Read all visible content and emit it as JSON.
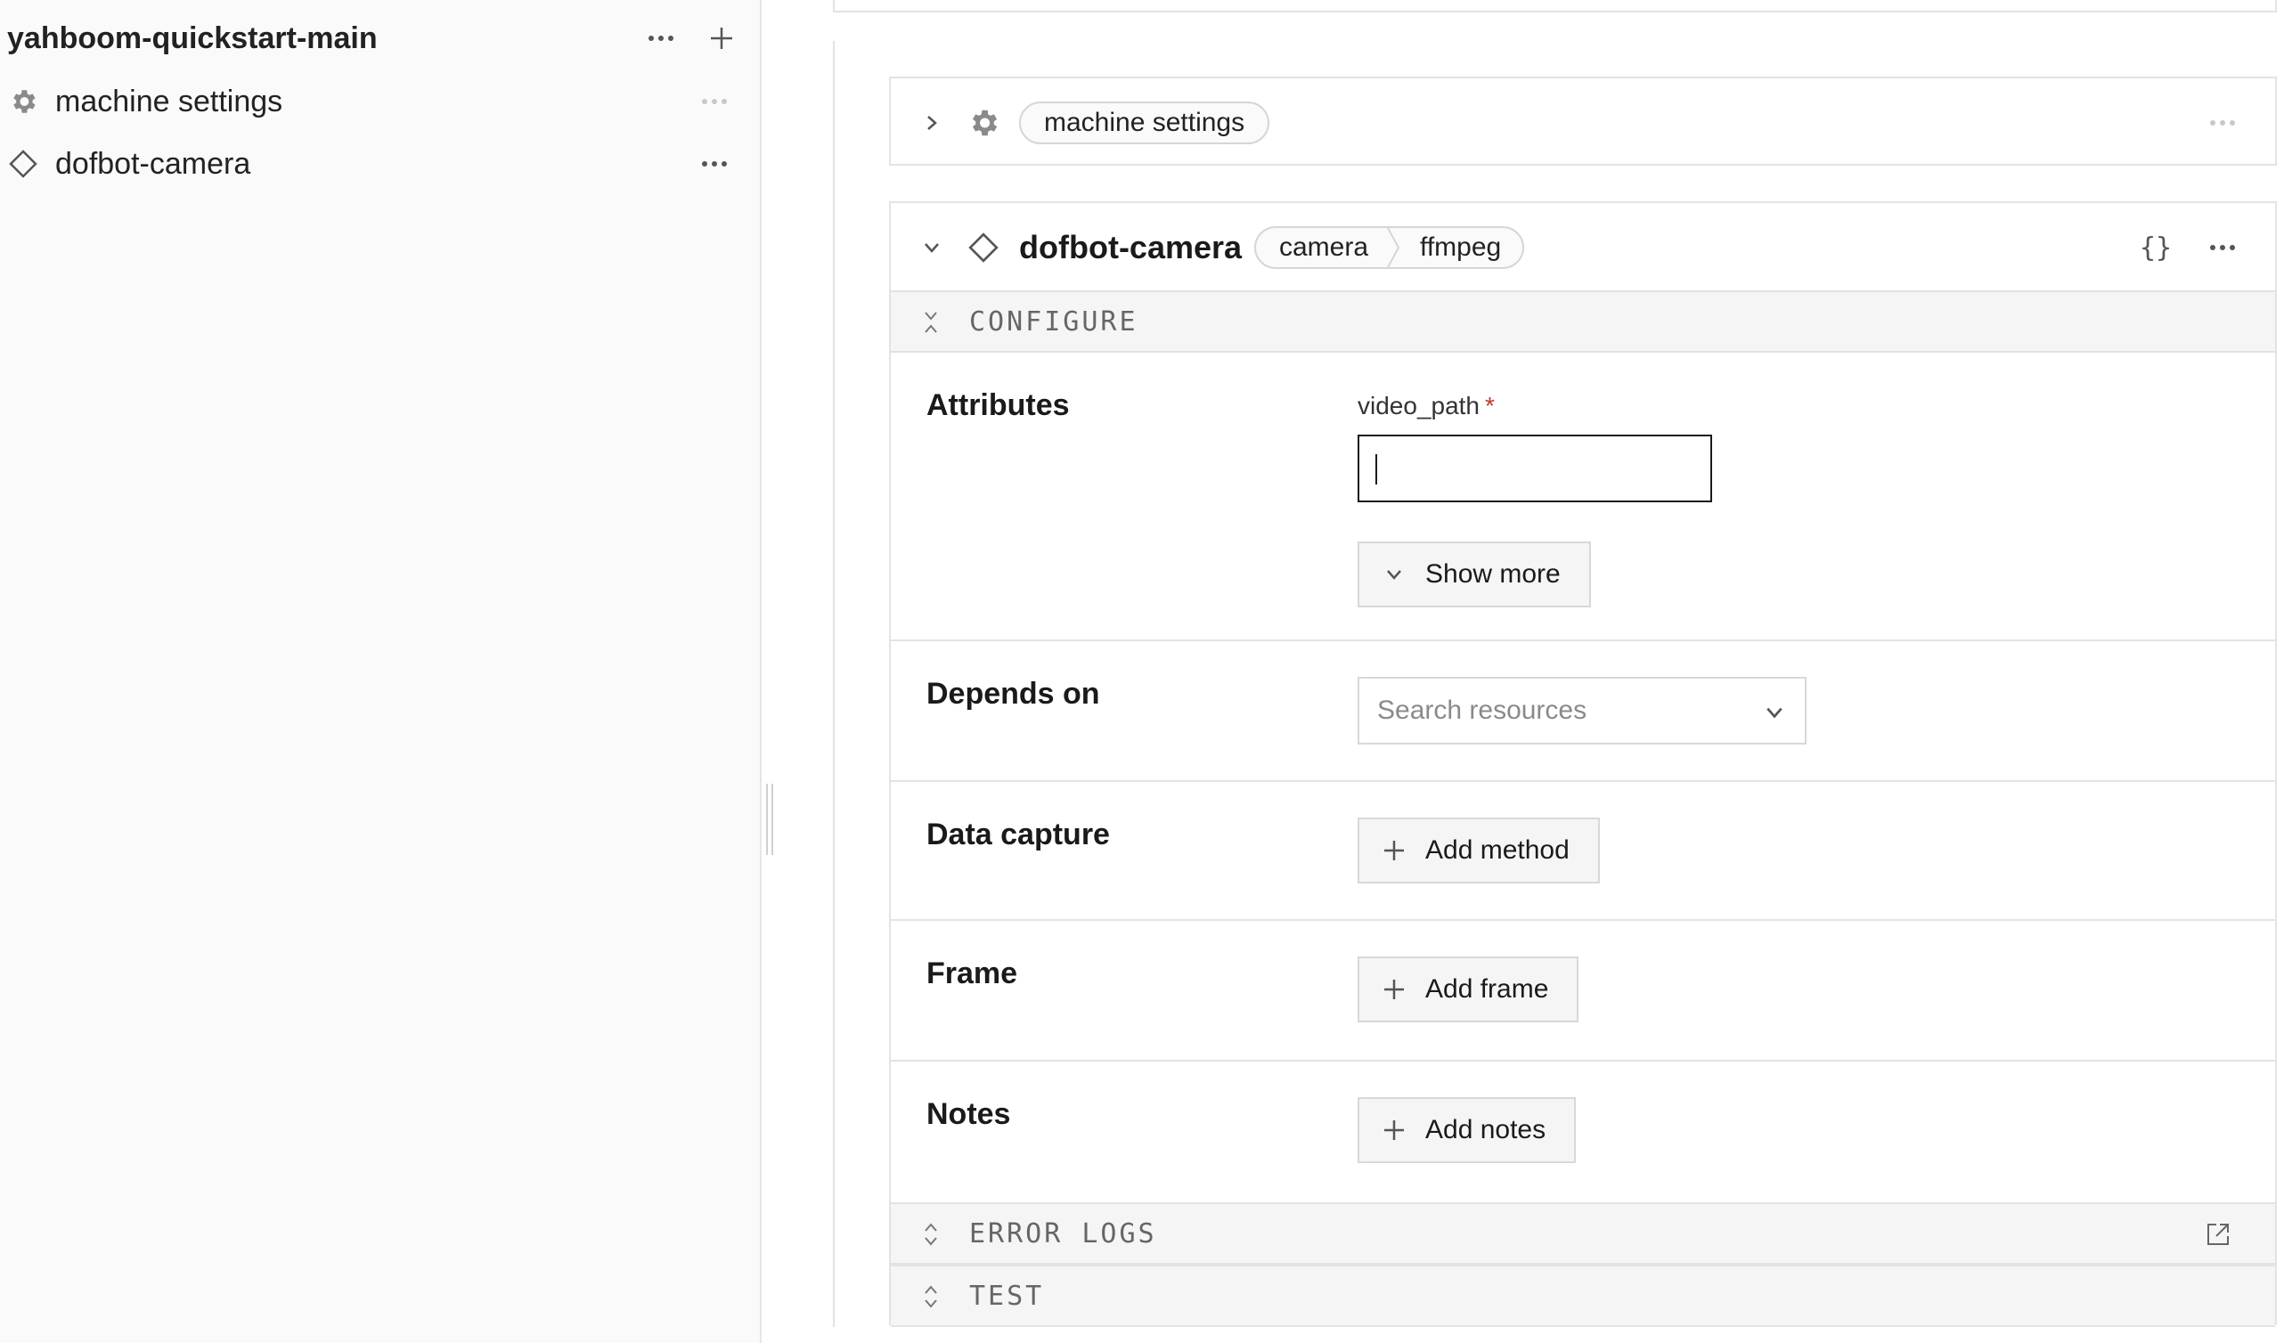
{
  "sidebar": {
    "title": "yahboom-quickstart-main",
    "items": [
      {
        "label": "machine settings",
        "icon": "gear-icon"
      },
      {
        "label": "dofbot-camera",
        "icon": "diamond-icon"
      }
    ]
  },
  "machine_settings_card": {
    "label": "machine settings"
  },
  "camera_card": {
    "name": "dofbot-camera",
    "api": "camera",
    "model": "ffmpeg",
    "json_label": "{}",
    "configure_label": "CONFIGURE",
    "attributes": {
      "label": "Attributes",
      "field_name": "video_path",
      "required_mark": "*",
      "value": "",
      "show_more": "Show more"
    },
    "depends_on": {
      "label": "Depends on",
      "placeholder": "Search resources"
    },
    "data_capture": {
      "label": "Data capture",
      "button": "Add method"
    },
    "frame": {
      "label": "Frame",
      "button": "Add frame"
    },
    "notes": {
      "label": "Notes",
      "button": "Add notes"
    },
    "error_logs_label": "ERROR LOGS",
    "test_label": "TEST"
  },
  "colors": {
    "required": "#c0392b",
    "border": "#e3e3e3",
    "sidebar_bg": "#fafafa"
  }
}
